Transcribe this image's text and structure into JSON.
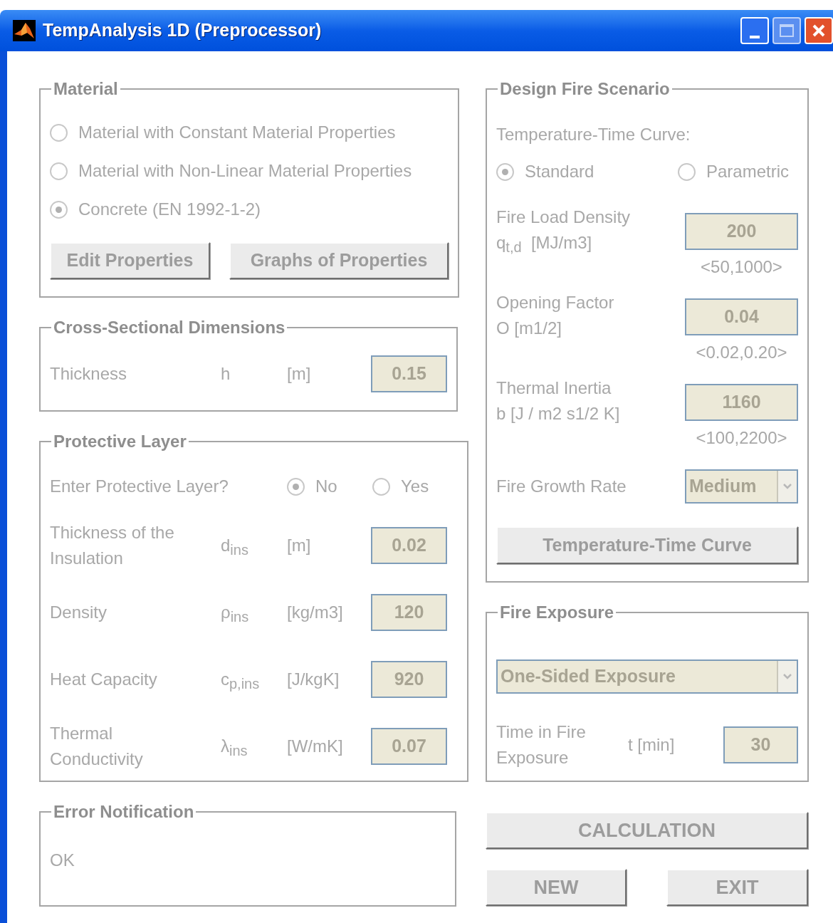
{
  "window": {
    "title": "TempAnalysis 1D (Preprocessor)"
  },
  "material": {
    "title": "Material",
    "options": [
      {
        "label": "Material with Constant Material Properties",
        "selected": false
      },
      {
        "label": "Material with Non-Linear Material Properties",
        "selected": false
      },
      {
        "label": "Concrete (EN 1992-1-2)",
        "selected": true
      }
    ],
    "buttons": [
      "Edit Properties",
      "Graphs of Properties"
    ]
  },
  "cross_section": {
    "title": "Cross-Sectional Dimensions",
    "rows": [
      {
        "label": "Thickness",
        "symbol": "h",
        "unit": "[m]",
        "value": "0.15"
      }
    ]
  },
  "protective_layer": {
    "title": "Protective Layer",
    "question": "Enter Protective Layer?",
    "options": [
      {
        "label": "No",
        "selected": true
      },
      {
        "label": "Yes",
        "selected": false
      }
    ],
    "rows": [
      {
        "label": "Thickness of the Insulation",
        "symbol": "d$_{ins}$",
        "unit": "[m]",
        "value": "0.02"
      },
      {
        "label": "Density",
        "symbol": "ρ$_{ins}$",
        "unit": "[kg/m3]",
        "value": "120"
      },
      {
        "label": "Heat Capacity",
        "symbol": "c$_{p,ins}$",
        "unit": "[J/kgK]",
        "value": "920"
      },
      {
        "label": "Thermal Conductivity",
        "symbol": "λ$_{ins}$",
        "unit": "[W/mK]",
        "value": "0.07"
      }
    ]
  },
  "error_notification": {
    "title": "Error Notification",
    "message": "OK"
  },
  "design_fire": {
    "title": "Design Fire Scenario",
    "curve_label": "Temperature-Time Curve:",
    "curve_options": [
      {
        "label": "Standard",
        "selected": true
      },
      {
        "label": "Parametric",
        "selected": false
      }
    ],
    "params": [
      {
        "kind": "field",
        "label": "Fire Load Density",
        "unit": "q$_{t,d}$  [MJ/m3]",
        "value": "200",
        "range": "<50,1000>"
      },
      {
        "kind": "field",
        "label": "Opening Factor",
        "unit": "O [m1/2]",
        "value": "0.04",
        "range": "<0.02,0.20>"
      },
      {
        "kind": "field",
        "label": "Thermal Inertia",
        "unit": "b [J / m2 s1/2 K]",
        "value": "1160",
        "range": "<100,2200>"
      },
      {
        "kind": "dropdown",
        "label": "Fire Growth Rate",
        "value": "Medium"
      }
    ],
    "button": "Temperature-Time Curve"
  },
  "fire_exposure": {
    "title": "Fire Exposure",
    "exposure": "One-Sided Exposure",
    "time": {
      "label": "Time in Fire Exposure",
      "unit": "t [min]",
      "value": "30"
    }
  },
  "actions": [
    "CALCULATION",
    "NEW",
    "EXIT"
  ]
}
